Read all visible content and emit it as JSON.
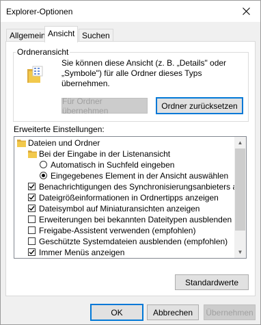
{
  "window": {
    "title": "Explorer-Optionen"
  },
  "tabs": [
    {
      "label": "Allgemein"
    },
    {
      "label": "Ansicht"
    },
    {
      "label": "Suchen"
    }
  ],
  "folder_view": {
    "legend": "Ordneransicht",
    "line1": "Sie können diese Ansicht (z. B. „Details\" oder",
    "line2": "„Symbole\") für alle Ordner dieses Typs übernehmen.",
    "apply_button": "Für Ordner übernehmen",
    "reset_button": "Ordner zurücksetzen"
  },
  "advanced": {
    "label": "Erweiterte Einstellungen:",
    "items": [
      {
        "type": "folder",
        "label": "Dateien und Ordner"
      },
      {
        "type": "folder",
        "label": "Bei der Eingabe in der Listenansicht"
      },
      {
        "type": "radio",
        "checked": false,
        "label": "Automatisch in Suchfeld eingeben"
      },
      {
        "type": "radio",
        "checked": true,
        "label": "Eingegebenes Element in der Ansicht auswählen"
      },
      {
        "type": "checkbox",
        "checked": true,
        "label": "Benachrichtigungen des Synchronisierungsanbieters anzeigen"
      },
      {
        "type": "checkbox",
        "checked": true,
        "label": "Dateigrößeinformationen in Ordnertipps anzeigen"
      },
      {
        "type": "checkbox",
        "checked": true,
        "label": "Dateisymbol auf Miniaturansichten anzeigen"
      },
      {
        "type": "checkbox",
        "checked": false,
        "label": "Erweiterungen bei bekannten Dateitypen ausblenden"
      },
      {
        "type": "checkbox",
        "checked": false,
        "label": "Freigabe-Assistent verwenden (empfohlen)"
      },
      {
        "type": "checkbox",
        "checked": false,
        "label": "Geschützte Systemdateien ausblenden (empfohlen)"
      },
      {
        "type": "checkbox",
        "checked": true,
        "label": "Immer Menüs anzeigen"
      }
    ]
  },
  "buttons": {
    "defaults": "Standardwerte",
    "ok": "OK",
    "cancel": "Abbrechen",
    "apply": "Übernehmen"
  },
  "colors": {
    "focus": "#0078d7",
    "folder": "#f2c94c"
  }
}
